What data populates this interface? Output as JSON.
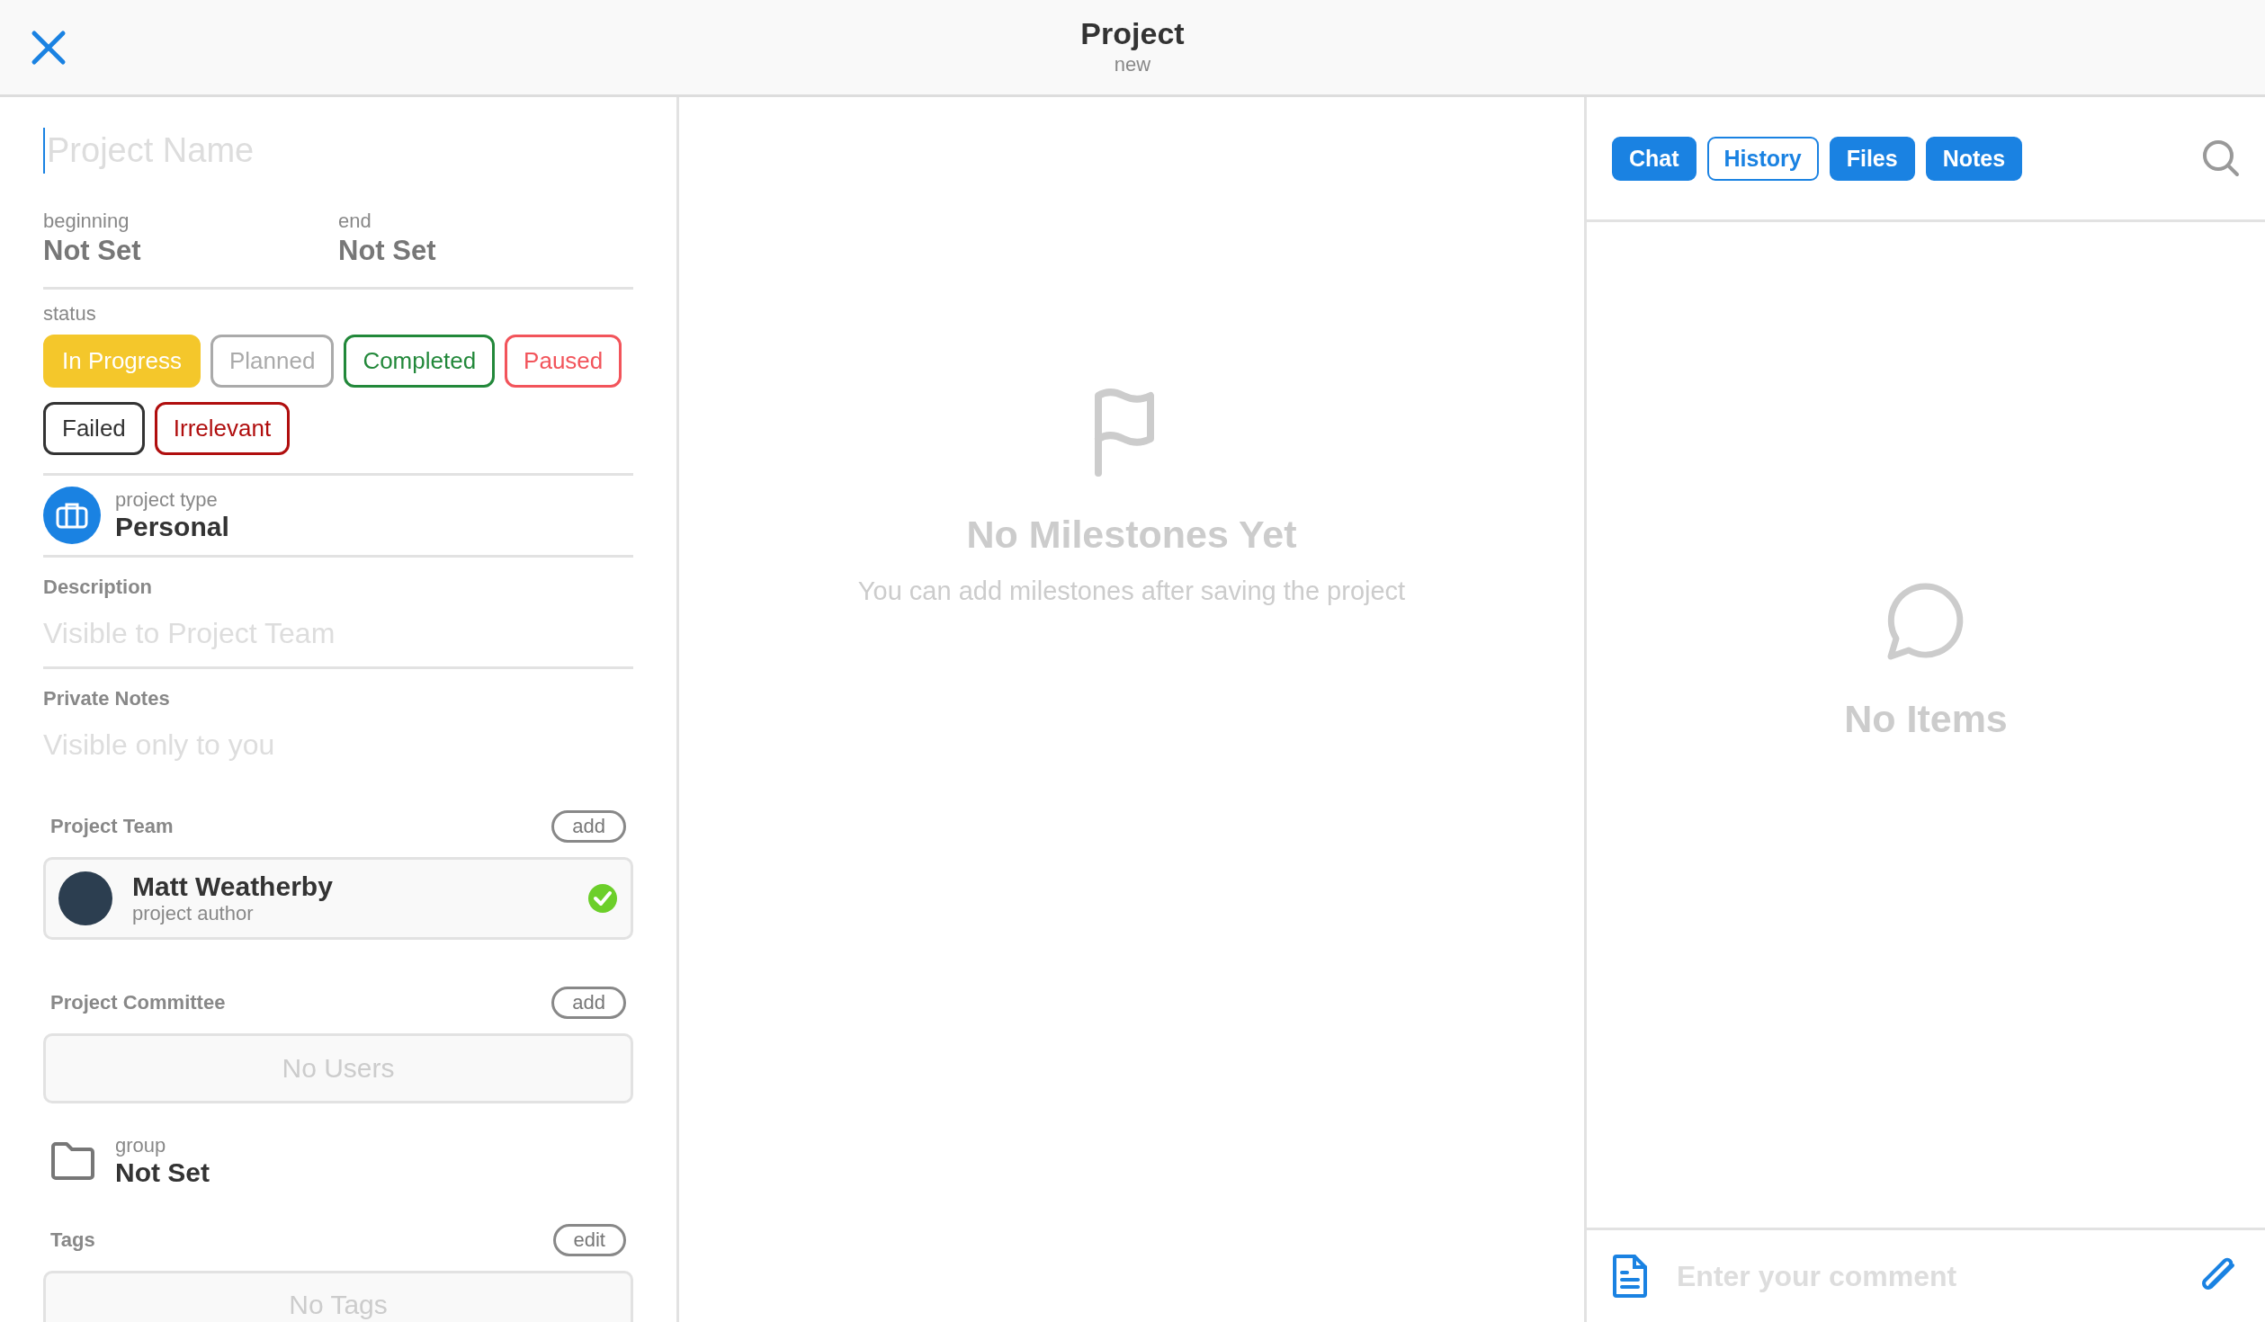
{
  "header": {
    "title": "Project",
    "subtitle": "new"
  },
  "form": {
    "name_placeholder": "Project Name",
    "dates": [
      {
        "label": "beginning",
        "value": "Not Set"
      },
      {
        "label": "end",
        "value": "Not Set"
      }
    ],
    "status_label": "status",
    "statuses": [
      {
        "label": "In Progress",
        "color": "#f4c72b",
        "selected": true
      },
      {
        "label": "Planned",
        "color": "#aaaaaa",
        "selected": false
      },
      {
        "label": "Completed",
        "color": "#22883a",
        "selected": false
      },
      {
        "label": "Paused",
        "color": "#f2545b",
        "selected": false
      },
      {
        "label": "Failed",
        "color": "#333333",
        "selected": false
      },
      {
        "label": "Irrelevant",
        "color": "#b00e0e",
        "selected": false
      }
    ],
    "project_type": {
      "label": "project type",
      "value": "Personal"
    },
    "description": {
      "label": "Description",
      "placeholder": "Visible to Project Team"
    },
    "private_notes": {
      "label": "Private Notes",
      "placeholder": "Visible only to you"
    },
    "team": {
      "label": "Project Team",
      "button": "add",
      "members": [
        {
          "name": "Matt Weatherby",
          "role": "project author",
          "verified": true
        }
      ]
    },
    "committee": {
      "label": "Project Committee",
      "button": "add",
      "empty": "No Users"
    },
    "group": {
      "label": "group",
      "value": "Not Set"
    },
    "tags": {
      "label": "Tags",
      "button": "edit",
      "empty": "No Tags"
    }
  },
  "milestones": {
    "title": "No Milestones Yet",
    "message": "You can add milestones after saving the project"
  },
  "side": {
    "tabs": [
      {
        "label": "Chat",
        "selected": false
      },
      {
        "label": "History",
        "selected": true
      },
      {
        "label": "Files",
        "selected": false
      },
      {
        "label": "Notes",
        "selected": false
      }
    ],
    "empty": "No Items",
    "comment_placeholder": "Enter your comment"
  }
}
